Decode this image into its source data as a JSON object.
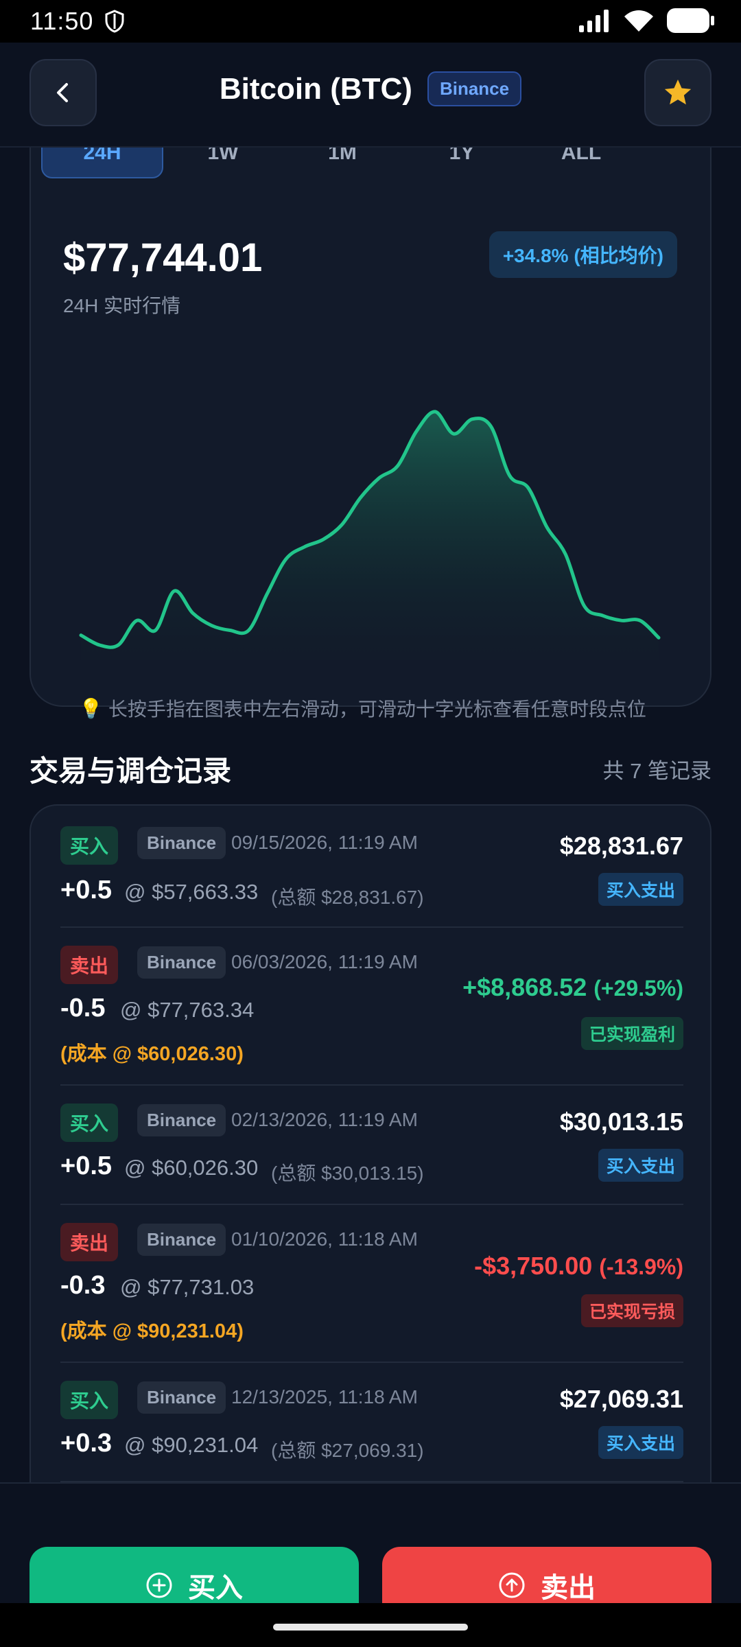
{
  "status": {
    "time": "11:50"
  },
  "header": {
    "title": "Bitcoin (BTC)",
    "exchange_badge": "Binance"
  },
  "chart": {
    "tabs": [
      {
        "label": "24H",
        "active": true
      },
      {
        "label": "1W",
        "active": false
      },
      {
        "label": "1M",
        "active": false
      },
      {
        "label": "1Y",
        "active": false
      },
      {
        "label": "ALL",
        "active": false
      }
    ],
    "price": "$77,744.01",
    "price_subtitle": "24H 实时行情",
    "change": "+34.8% (相比均价)",
    "hint": "长按手指在图表中左右滑动，可滑动十字光标查看任意时段点位",
    "line_color": "#22c58b"
  },
  "chart_data": {
    "type": "area",
    "title": "",
    "series": [
      {
        "values": [
          0.04,
          0.0,
          0.0,
          0.1,
          0.06,
          0.22,
          0.13,
          0.08,
          0.06,
          0.06,
          0.21,
          0.35,
          0.4,
          0.43,
          0.49,
          0.6,
          0.68,
          0.73,
          0.87,
          0.95,
          0.86,
          0.92,
          0.89,
          0.69,
          0.64,
          0.48,
          0.37,
          0.16,
          0.12,
          0.1,
          0.1,
          0.03
        ]
      }
    ],
    "grid": false
  },
  "trades": {
    "section_title": "交易与调仓记录",
    "count_label": "共 7 笔记录",
    "items": [
      {
        "type": "买入",
        "kind": "buy",
        "exchange": "Binance",
        "date": "09/15/2026, 11:19 AM",
        "qty": "+0.5",
        "price": "@ $57,663.33",
        "extra": "(总额 $28,831.67)",
        "amount": "$28,831.67",
        "pct": "",
        "badge": "买入支出"
      },
      {
        "type": "卖出",
        "kind": "sell",
        "exchange": "Binance",
        "date": "06/03/2026, 11:19 AM",
        "qty": "-0.5",
        "price": "@ $77,763.34",
        "cost": "(成本 @ $60,026.30)",
        "amount": "+$8,868.52",
        "pct": "(+29.5%)",
        "badge": "已实现盈利"
      },
      {
        "type": "买入",
        "kind": "buy",
        "exchange": "Binance",
        "date": "02/13/2026, 11:19 AM",
        "qty": "+0.5",
        "price": "@ $60,026.30",
        "extra": "(总额 $30,013.15)",
        "amount": "$30,013.15",
        "pct": "",
        "badge": "买入支出"
      },
      {
        "type": "卖出",
        "kind": "sell",
        "exchange": "Binance",
        "date": "01/10/2026, 11:18 AM",
        "qty": "-0.3",
        "price": "@ $77,731.03",
        "cost": "(成本 @ $90,231.04)",
        "amount": "-$3,750.00",
        "pct": "(-13.9%)",
        "badge": "已实现亏损"
      },
      {
        "type": "买入",
        "kind": "buy",
        "exchange": "Binance",
        "date": "12/13/2025, 11:18 AM",
        "qty": "+0.3",
        "price": "@ $90,231.04",
        "extra": "(总额 $27,069.31)",
        "amount": "$27,069.31",
        "pct": "",
        "badge": "买入支出"
      }
    ]
  },
  "actions": {
    "buy_label": "买入",
    "sell_label": "卖出"
  }
}
